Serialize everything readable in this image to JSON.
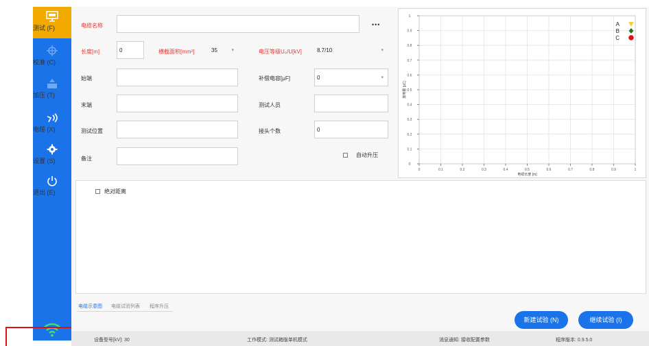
{
  "sidebar": {
    "items": [
      {
        "label": "测试 (F)",
        "icon": "monitor-icon",
        "state": "active"
      },
      {
        "label": "校准 (C)",
        "icon": "target-icon",
        "state": "disabled"
      },
      {
        "label": "加压 (T)",
        "icon": "tray-icon",
        "state": "disabled"
      },
      {
        "label": "电缆 (X)",
        "icon": "signal-icon",
        "state": "normal"
      },
      {
        "label": "设置 (S)",
        "icon": "gear-icon",
        "state": "normal"
      },
      {
        "label": "退出 (E)",
        "icon": "power-icon",
        "state": "normal"
      }
    ],
    "status_icon": "wifi-icon"
  },
  "form": {
    "cable_name_label": "电缆名称",
    "cable_name_value": "",
    "more_label": "•••",
    "length_label": "长度[m]",
    "length_value": "0",
    "area_label": "横截面积[mm²]",
    "area_value": "35",
    "voltage_label": "电压等级U₀/U[kV]",
    "voltage_value": "8.7/10",
    "start_label": "始端",
    "start_value": "",
    "cap_label": "补偿电容[μF]",
    "cap_value": "0",
    "end_label": "末端",
    "end_value": "",
    "tester_label": "测试人员",
    "tester_value": "",
    "location_label": "测试位置",
    "location_value": "",
    "joints_label": "接头个数",
    "joints_value": "0",
    "remark_label": "备注",
    "remark_value": "",
    "auto_boost_label": "自动升压",
    "abs_distance_label": "绝对距离"
  },
  "tabs": [
    "电缆示意图",
    "电缆试验列表",
    "程序升压"
  ],
  "buttons": {
    "new_test": "新建试验 (N)",
    "continue_test": "继续试验 (I)"
  },
  "status_bar": {
    "device": "设备型号[kV]: 30",
    "mode": "工作模式: 测试箱版单机模式",
    "message": "消息通知: 接收配置参数",
    "version": "程序版本: 0.9.5.0"
  },
  "chart_data": {
    "type": "scatter",
    "xlabel": "电缆长度 [m]",
    "ylabel": "放电量 [pC]",
    "xlim": [
      0,
      1
    ],
    "ylim": [
      0,
      1
    ],
    "x_ticks": [
      "0",
      "0.1",
      "0.2",
      "0.3",
      "0.4",
      "0.5",
      "0.6",
      "0.7",
      "0.8",
      "0.9",
      "1"
    ],
    "y_ticks": [
      "0",
      "0.1",
      "0.2",
      "0.3",
      "0.4",
      "0.5",
      "0.6",
      "0.7",
      "0.8",
      "0.9",
      "1"
    ],
    "grid": true,
    "legend_position": "top-right",
    "series": [
      {
        "name": "A",
        "marker": "triangle-down",
        "color": "#f5d33a",
        "x": [],
        "y": []
      },
      {
        "name": "B",
        "marker": "diamond",
        "color": "#1f7a1f",
        "x": [],
        "y": []
      },
      {
        "name": "C",
        "marker": "circle",
        "color": "#e01010",
        "x": [],
        "y": []
      }
    ]
  }
}
